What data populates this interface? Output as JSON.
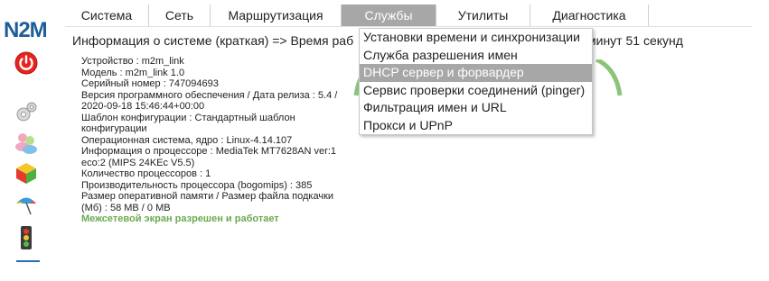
{
  "logo": {
    "text": "N2M"
  },
  "menu": [
    {
      "label": "Система"
    },
    {
      "label": "Сеть"
    },
    {
      "label": "Маршрутизация"
    },
    {
      "label": "Службы"
    },
    {
      "label": "Утилиты"
    },
    {
      "label": "Диагностика"
    }
  ],
  "info": {
    "title": "Информация о системе (краткая) => Время раб",
    "title_tail": "минут 51 секунд",
    "lines": [
      "Устройство : m2m_link",
      "Модель : m2m_link 1.0",
      "Серийный номер : 747094693",
      "Версия программного обеспечения / Дата релиза : 5.4 / 2020-09-18 15:46:44+00:00",
      "Шаблон конфигурации : Стандартный шаблон конфигурации",
      "Операционная система, ядро : Linux-4.14.107",
      "Информация о процессоре : MediaTek MT7628AN ver:1 eco:2 (MIPS 24KEc V5.5)",
      "Количество процессоров : 1",
      "Производительность процессора (bogomips) : 385",
      "Размер оперативной памяти / Размер файла подкачки (Мб) : 58 MB / 0 MB"
    ],
    "firewall": "Межсетевой экран разрешен и работает"
  },
  "dropdown": [
    {
      "label": "Установки времени и синхронизации"
    },
    {
      "label": "Служба разрешения имен"
    },
    {
      "label": "DHCP сервер и форвардер"
    },
    {
      "label": "Сервис проверки соединений (pinger)"
    },
    {
      "label": "Фильтрация имен и URL"
    },
    {
      "label": "Прокси и UPnP"
    }
  ],
  "colors": {
    "logo": "#1c5e98",
    "active_menu_bg": "#a7a7a7",
    "firewall_text": "#6aab4f",
    "gauge": "#8bc47a"
  },
  "icons": [
    "power-icon",
    "settings-gear-icon",
    "users-icon",
    "packages-icon",
    "umbrella-icon",
    "traffic-light-icon"
  ]
}
